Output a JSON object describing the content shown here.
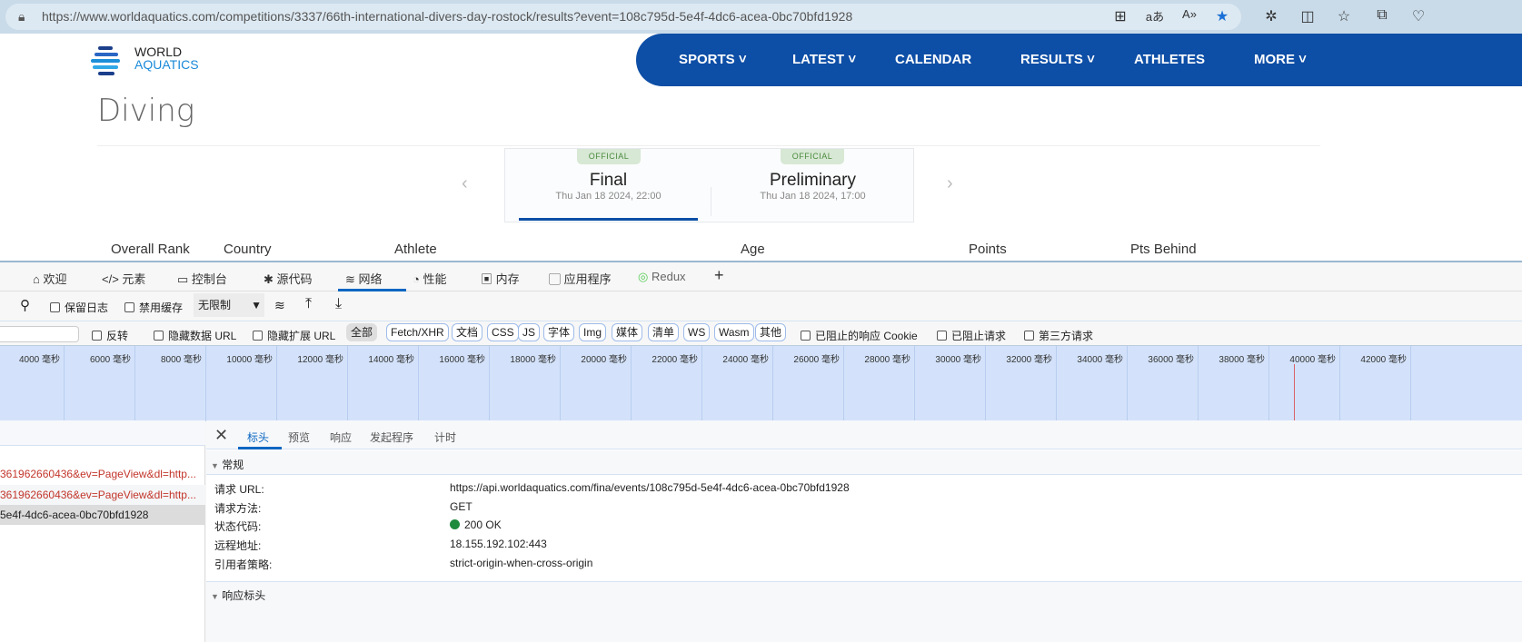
{
  "browser": {
    "url": "https://www.worldaquatics.com/competitions/3337/66th-international-divers-day-rostock/results?event=108c795d-5e4f-4dc6-acea-0bc70bfd1928"
  },
  "site": {
    "logo_line1": "WORLD",
    "logo_line2": "AQUATICS",
    "nav": [
      "SPORTS",
      "LATEST",
      "CALENDAR",
      "RESULTS",
      "ATHLETES",
      "MORE"
    ],
    "page_title": "Diving",
    "events": [
      {
        "badge": "OFFICIAL",
        "name": "Final",
        "date": "Thu Jan 18 2024, 22:00"
      },
      {
        "badge": "OFFICIAL",
        "name": "Preliminary",
        "date": "Thu Jan 18 2024, 17:00"
      }
    ],
    "columns": [
      "Overall Rank",
      "Country",
      "Athlete",
      "Age",
      "Points",
      "Pts Behind"
    ]
  },
  "devtools": {
    "tabs": [
      "欢迎",
      "元素",
      "控制台",
      "源代码",
      "网络",
      "性能",
      "内存",
      "应用程序",
      "Redux"
    ],
    "toolbar": {
      "preserve_log": "保留日志",
      "disable_cache": "禁用缓存",
      "throttle": "无限制"
    },
    "filters": {
      "invert": "反转",
      "hide_data_url": "隐藏数据 URL",
      "hide_ext_url": "隐藏扩展 URL",
      "types": [
        "全部",
        "Fetch/XHR",
        "文档",
        "CSS",
        "JS",
        "字体",
        "Img",
        "媒体",
        "清单",
        "WS",
        "Wasm",
        "其他"
      ],
      "blocked_cookies": "已阻止的响应 Cookie",
      "blocked_requests": "已阻止请求",
      "third_party": "第三方请求"
    },
    "timeline_ticks": [
      "4000 毫秒",
      "6000 毫秒",
      "8000 毫秒",
      "10000 毫秒",
      "12000 毫秒",
      "14000 毫秒",
      "16000 毫秒",
      "18000 毫秒",
      "20000 毫秒",
      "22000 毫秒",
      "24000 毫秒",
      "26000 毫秒",
      "28000 毫秒",
      "30000 毫秒",
      "32000 毫秒",
      "34000 毫秒",
      "36000 毫秒",
      "38000 毫秒",
      "40000 毫秒",
      "42000 毫秒"
    ],
    "requests": [
      "361962660436&ev=PageView&dl=http...",
      "361962660436&ev=PageView&dl=http...",
      "5e4f-4dc6-acea-0bc70bfd1928"
    ],
    "detail_tabs": [
      "标头",
      "预览",
      "响应",
      "发起程序",
      "计时"
    ],
    "general_label": "常规",
    "general": [
      {
        "k": "请求 URL:",
        "v": "https://api.worldaquatics.com/fina/events/108c795d-5e4f-4dc6-acea-0bc70bfd1928"
      },
      {
        "k": "请求方法:",
        "v": "GET"
      },
      {
        "k": "状态代码:",
        "v": "200 OK"
      },
      {
        "k": "远程地址:",
        "v": "18.155.192.102:443"
      },
      {
        "k": "引用者策略:",
        "v": "strict-origin-when-cross-origin"
      }
    ],
    "response_headers_label": "响应标头"
  }
}
